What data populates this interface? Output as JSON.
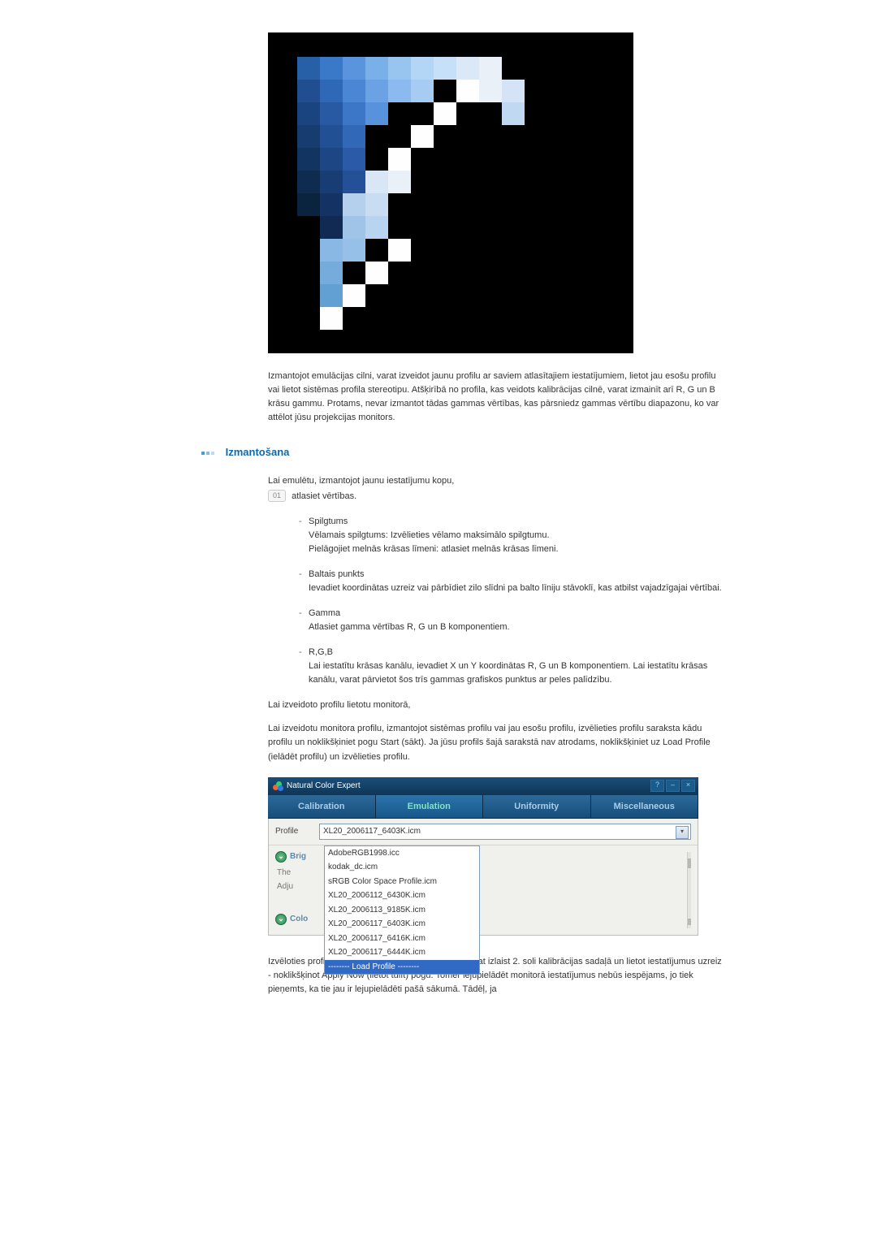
{
  "intro_paragraph": "Izmantojot emulācijas cilni, varat izveidot jaunu profilu ar saviem atlasītajiem iestatījumiem, lietot jau esošu profilu vai lietot sistēmas profila stereotipu. Atšķirībā no profila, kas veidots kalibrācijas cilnē, varat izmainīt arī R, G un B krāsu gammu. Protams, nevar izmantot tādas gammas vērtības, kas pārsniedz gammas vērtību diapazonu, ko var attēlot jūsu projekcijas monitors.",
  "section_title": "Izmantošana",
  "step_intro": "Lai emulētu, izmantojot jaunu iestatījumu kopu,",
  "step_badge": "01",
  "step_text": "atlasiet vērtības.",
  "bullets": [
    {
      "title": "Spilgtums",
      "body": "Vēlamais spilgtums: Izvēlieties vēlamo maksimālo spilgtumu.\nPielāgojiet melnās krāsas līmeni: atlasiet melnās krāsas līmeni."
    },
    {
      "title": "Baltais punkts",
      "body": "Ievadiet koordinātas uzreiz vai pārbīdiet zilo slīdni pa balto līniju stāvoklī, kas atbilst vajadzīgajai vērtībai."
    },
    {
      "title": "Gamma",
      "body": "Atlasiet gamma vērtības R, G un B komponentiem."
    },
    {
      "title": "R,G,B",
      "body": "Lai iestatītu krāsas kanālu, ievadiet X un Y koordinātas R, G un B komponentiem. Lai iestatītu krāsas kanālu, varat pārvietot šos trīs gammas grafiskos punktus ar peles palīdzību."
    }
  ],
  "post1": "Lai izveidoto profilu lietotu monitorā,",
  "post2": "Lai izveidotu monitora profilu, izmantojot sistēmas profilu vai jau esošu profilu, izvēlieties profilu saraksta kādu profilu un noklikšķiniet pogu Start (sākt). Ja jūsu profils šajā sarakstā nav atrodams, noklikšķiniet uz Load Profile (ielādēt profilu) un izvēlieties profilu.",
  "app": {
    "title": "Natural Color Expert",
    "window_buttons": {
      "help": "?",
      "min": "–",
      "close": "×"
    },
    "tabs": [
      "Calibration",
      "Emulation",
      "Uniformity",
      "Miscellaneous"
    ],
    "active_tab": 1,
    "profile_label": "Profile",
    "profile_selected": "XL20_2006117_6403K.icm",
    "side": {
      "brig": "Brig",
      "the": "The",
      "adju": "Adju",
      "colo": "Colo"
    },
    "options": [
      "AdobeRGB1998.icc",
      "kodak_dc.icm",
      "sRGB Color Space Profile.icm",
      "XL20_2006112_6430K.icm",
      "XL20_2006113_9185K.icm",
      "XL20_2006117_6403K.icm",
      "XL20_2006117_6416K.icm",
      "XL20_2006117_6444K.icm",
      "-------- Load Profile --------"
    ],
    "selected_option_index": 8
  },
  "outro": "Izvēloties profilu, kuram jau esat veicis emulāciju, varat izlaist 2. soli kalibrācijas sadaļā un lietot iestatījumus uzreiz - noklikšķinot Apply Now (lietot tūlīt) pogu. Tomēr lejupielādēt monitorā iestatījumus nebūs iespējams, jo tiek pieņemts, ka tie jau ir lejupielādēti pašā sākumā. Tādēļ, ja"
}
